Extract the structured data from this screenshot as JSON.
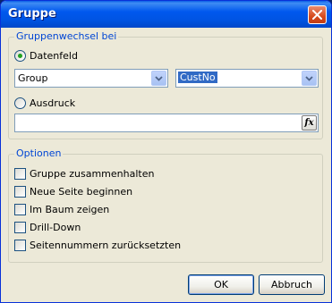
{
  "window": {
    "title": "Gruppe"
  },
  "group_change": {
    "legend": "Gruppenwechsel bei",
    "data_field": {
      "label": "Datenfeld",
      "selected": true,
      "table_value": "Group",
      "field_value": "CustNo"
    },
    "expression": {
      "label": "Ausdruck",
      "selected": false,
      "value": "",
      "fx_label": "fx"
    }
  },
  "options": {
    "legend": "Optionen",
    "items": [
      {
        "label": "Gruppe zusammenhalten",
        "checked": false
      },
      {
        "label": "Neue Seite beginnen",
        "checked": false
      },
      {
        "label": "Im Baum zeigen",
        "checked": false
      },
      {
        "label": "Drill-Down",
        "checked": false
      },
      {
        "label": "Seitennummern zurücksetzten",
        "checked": false
      }
    ]
  },
  "buttons": {
    "ok": "OK",
    "cancel": "Abbruch"
  },
  "colors": {
    "title_bar": "#0054e3",
    "group_legend": "#0046d5",
    "selection": "#316ac5",
    "radio_dot": "#21a121"
  }
}
